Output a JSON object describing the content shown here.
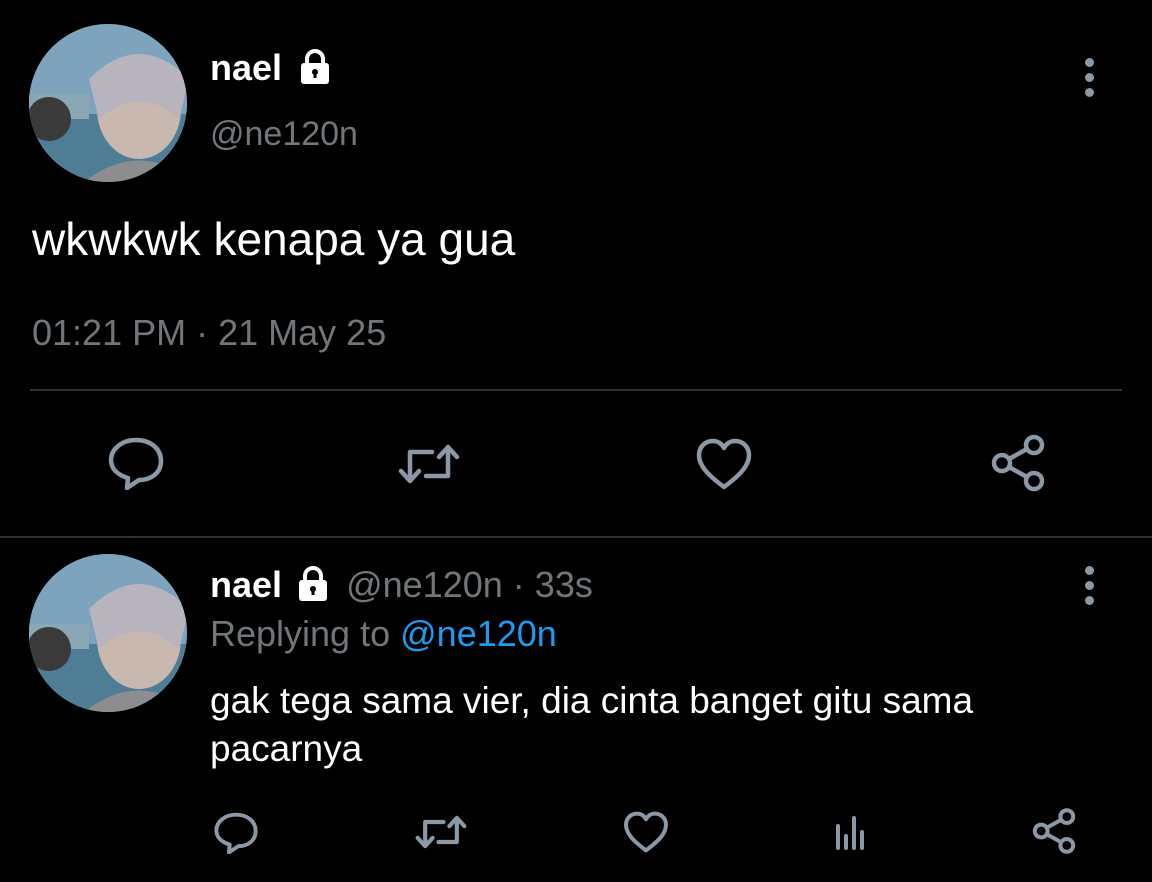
{
  "main_tweet": {
    "author_name": "nael",
    "handle": "@ne120n",
    "text": "wkwkwk kenapa ya gua",
    "time": "01:21 PM",
    "separator": "·",
    "date": "21 May 25",
    "actions": [
      "reply-icon",
      "retweet-icon",
      "like-icon",
      "share-icon"
    ]
  },
  "reply_tweet": {
    "author_name": "nael",
    "handle": "@ne120n",
    "separator": "·",
    "age": "33s",
    "replying_prefix": "Replying to",
    "replying_handle": "@ne120n",
    "text_line1": "gak tega sama vier, dia cinta banget gitu sama",
    "text_line2": "pacarnya",
    "actions": [
      "reply-icon",
      "retweet-icon",
      "like-icon",
      "analytics-icon",
      "share-icon"
    ]
  },
  "colors": {
    "background": "#000000",
    "text": "#e7e9ea",
    "muted": "#71767b",
    "link": "#1d9bf0",
    "divider": "#2f3336",
    "icon": "#8b98a5"
  }
}
